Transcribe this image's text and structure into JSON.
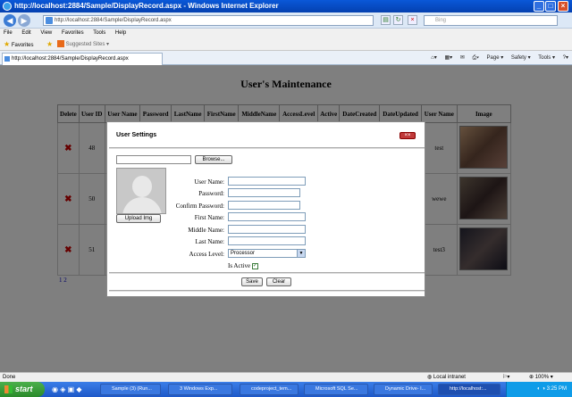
{
  "window": {
    "title": "http://localhost:2884/Sample/DisplayRecord.aspx - Windows Internet Explorer"
  },
  "address": {
    "url": "http://localhost:2884/Sample/DisplayRecord.aspx",
    "search_placeholder": "Bing"
  },
  "menu": [
    "File",
    "Edit",
    "View",
    "Favorites",
    "Tools",
    "Help"
  ],
  "favorites": {
    "label": "Favorites",
    "suggested": "Suggested Sites ▾"
  },
  "tab": {
    "label": "http://localhost:2884/Sample/DisplayRecord.aspx"
  },
  "commands": [
    "Page ▾",
    "Safety ▾",
    "Tools ▾"
  ],
  "page": {
    "title": "User's Maintenance",
    "columns": [
      "Delete",
      "User ID",
      "User Name",
      "Password",
      "LastName",
      "FirstName",
      "MiddleName",
      "AccessLevel",
      "Active",
      "DateCreated",
      "DateUpdated",
      "User Name",
      "Image"
    ],
    "rows": [
      {
        "id": "48",
        "user": "test"
      },
      {
        "id": "50",
        "user": "wewe"
      },
      {
        "id": "51",
        "user": "test3"
      }
    ],
    "pager": "1 2"
  },
  "modal": {
    "title": "User Settings",
    "browse_label": "Browse...",
    "upload_label": "Upload Img",
    "fields": {
      "username": "User Name:",
      "password": "Password:",
      "confirm": "Confirm Password:",
      "first": "First Name:",
      "middle": "Middle Name:",
      "last": "Last Name:",
      "access": "Access Level:"
    },
    "access_value": "Processor",
    "is_active_label": "Is Active",
    "save_label": "Save",
    "clear_label": "Clear"
  },
  "status": {
    "left": "Done",
    "zone": "Local intranet",
    "zoom": "100%"
  },
  "taskbar": {
    "start": "start",
    "items": [
      "Sample (3) (Run...",
      "3 Windows Exp...",
      "codeproject_tem...",
      "Microsoft SQL Se...",
      "Dynamic Drive- I...",
      "http://localhost:..."
    ],
    "clock": "3:25 PM"
  }
}
